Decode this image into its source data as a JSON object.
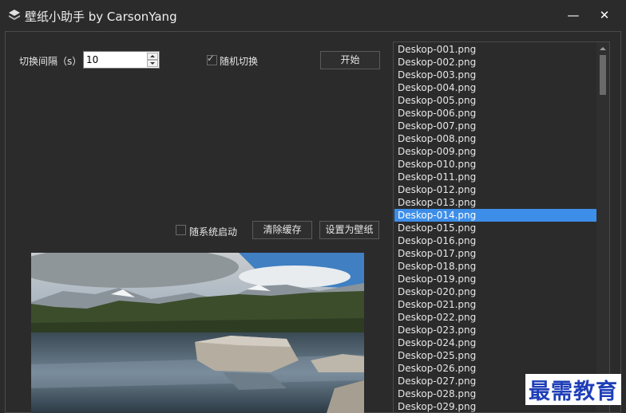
{
  "window": {
    "title": "壁纸小助手 by CarsonYang",
    "minimize_label": "—",
    "close_label": "✕"
  },
  "settings": {
    "interval_label": "切换间隔（s）",
    "interval_value": "10",
    "random_label": "随机切换",
    "random_checked": true,
    "start_label": "开始",
    "startup_label": "随系统启动",
    "startup_checked": false,
    "clear_cache_label": "清除缓存",
    "set_wallpaper_label": "设置为壁纸"
  },
  "file_list": {
    "selected_index": 13,
    "items": [
      "Deskop-001.png",
      "Deskop-002.png",
      "Deskop-003.png",
      "Deskop-004.png",
      "Deskop-005.png",
      "Deskop-006.png",
      "Deskop-007.png",
      "Deskop-008.png",
      "Deskop-009.png",
      "Deskop-010.png",
      "Deskop-011.png",
      "Deskop-012.png",
      "Deskop-013.png",
      "Deskop-014.png",
      "Deskop-015.png",
      "Deskop-016.png",
      "Deskop-017.png",
      "Deskop-018.png",
      "Deskop-019.png",
      "Deskop-020.png",
      "Deskop-021.png",
      "Deskop-022.png",
      "Deskop-023.png",
      "Deskop-024.png",
      "Deskop-025.png",
      "Deskop-026.png",
      "Deskop-027.png",
      "Deskop-028.png",
      "Deskop-029.png"
    ]
  },
  "watermark": {
    "text": "最需教育",
    "color": "#1f3fb8"
  },
  "colors": {
    "background": "#2b2b2b",
    "selection": "#3d8ee8"
  }
}
